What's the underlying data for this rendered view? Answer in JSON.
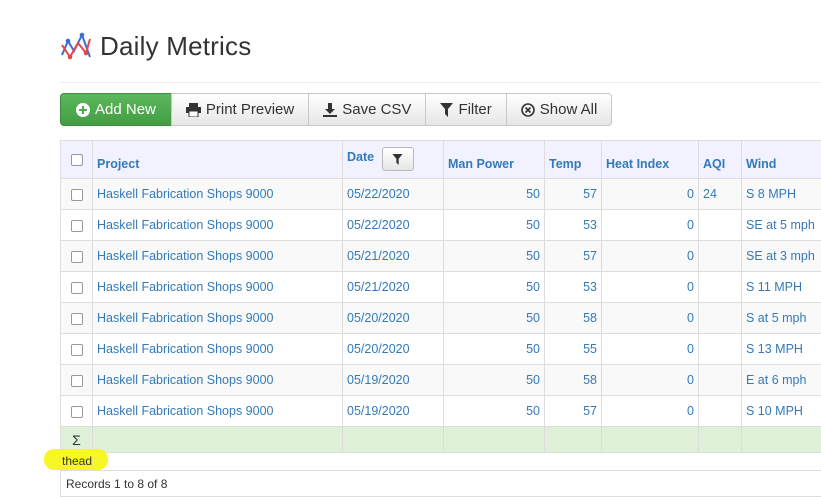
{
  "page": {
    "title": "Daily Metrics",
    "icon": "line-chart-icon"
  },
  "toolbar": {
    "add_new": "Add New",
    "print_preview": "Print Preview",
    "save_csv": "Save CSV",
    "filter": "Filter",
    "show_all": "Show All"
  },
  "table": {
    "columns": {
      "project": "Project",
      "date": "Date",
      "man_power": "Man Power",
      "temp": "Temp",
      "heat_index": "Heat Index",
      "aqi": "AQI",
      "wind": "Wind"
    },
    "rows": [
      {
        "project": "Haskell Fabrication Shops 9000",
        "date": "05/22/2020",
        "man_power": "50",
        "temp": "57",
        "heat_index": "0",
        "aqi": "24",
        "wind": "S 8 MPH"
      },
      {
        "project": "Haskell Fabrication Shops 9000",
        "date": "05/22/2020",
        "man_power": "50",
        "temp": "53",
        "heat_index": "0",
        "aqi": "",
        "wind": "SE at 5 mph"
      },
      {
        "project": "Haskell Fabrication Shops 9000",
        "date": "05/21/2020",
        "man_power": "50",
        "temp": "57",
        "heat_index": "0",
        "aqi": "",
        "wind": "SE at 3 mph"
      },
      {
        "project": "Haskell Fabrication Shops 9000",
        "date": "05/21/2020",
        "man_power": "50",
        "temp": "53",
        "heat_index": "0",
        "aqi": "",
        "wind": "S 11 MPH"
      },
      {
        "project": "Haskell Fabrication Shops 9000",
        "date": "05/20/2020",
        "man_power": "50",
        "temp": "58",
        "heat_index": "0",
        "aqi": "",
        "wind": "S at 5 mph"
      },
      {
        "project": "Haskell Fabrication Shops 9000",
        "date": "05/20/2020",
        "man_power": "50",
        "temp": "55",
        "heat_index": "0",
        "aqi": "",
        "wind": "S 13 MPH"
      },
      {
        "project": "Haskell Fabrication Shops 9000",
        "date": "05/19/2020",
        "man_power": "50",
        "temp": "58",
        "heat_index": "0",
        "aqi": "",
        "wind": "E at 6 mph"
      },
      {
        "project": "Haskell Fabrication Shops 9000",
        "date": "05/19/2020",
        "man_power": "50",
        "temp": "57",
        "heat_index": "0",
        "aqi": "",
        "wind": "S 10 MPH"
      }
    ],
    "summary_symbol": "Σ"
  },
  "annotation": {
    "text": "thead",
    "highlight_color": "#f7f71a"
  },
  "footer": {
    "records": "Records 1 to 8 of 8"
  },
  "colors": {
    "link": "#337ab7",
    "primary_button": "#5cb85c",
    "header_bg": "#f1f1ff",
    "summary_bg": "#dff0d8"
  }
}
